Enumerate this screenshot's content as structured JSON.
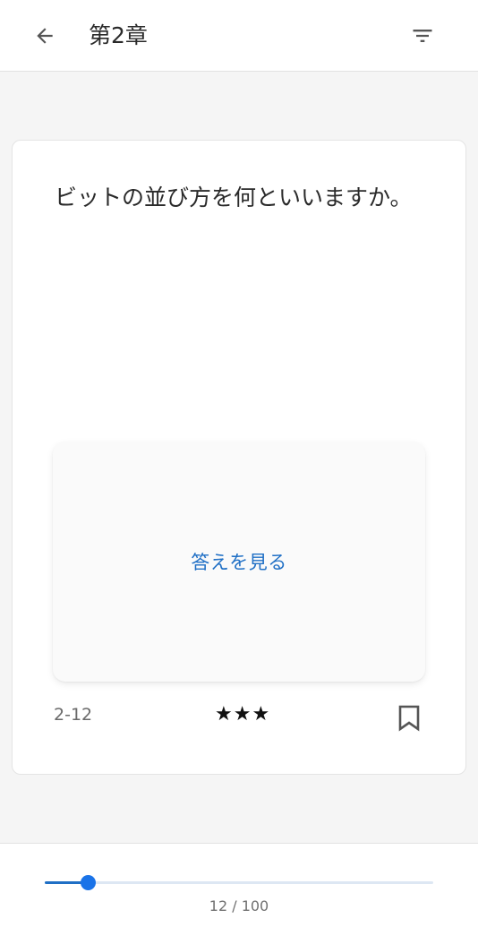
{
  "header": {
    "title": "第2章",
    "back_icon": "arrow-back-icon",
    "filter_icon": "filter-list-icon"
  },
  "card": {
    "question": "ビットの並び方を何といいますか。",
    "answer_button_label": "答えを見る",
    "question_number": "2-12",
    "stars": "★★★",
    "bookmark_icon": "bookmark-outline-icon"
  },
  "progress": {
    "current": 12,
    "total": 100,
    "label": "12 / 100"
  },
  "colors": {
    "accent": "#1a73e8",
    "link_text": "#1f6fc5",
    "background": "#f5f5f5"
  }
}
